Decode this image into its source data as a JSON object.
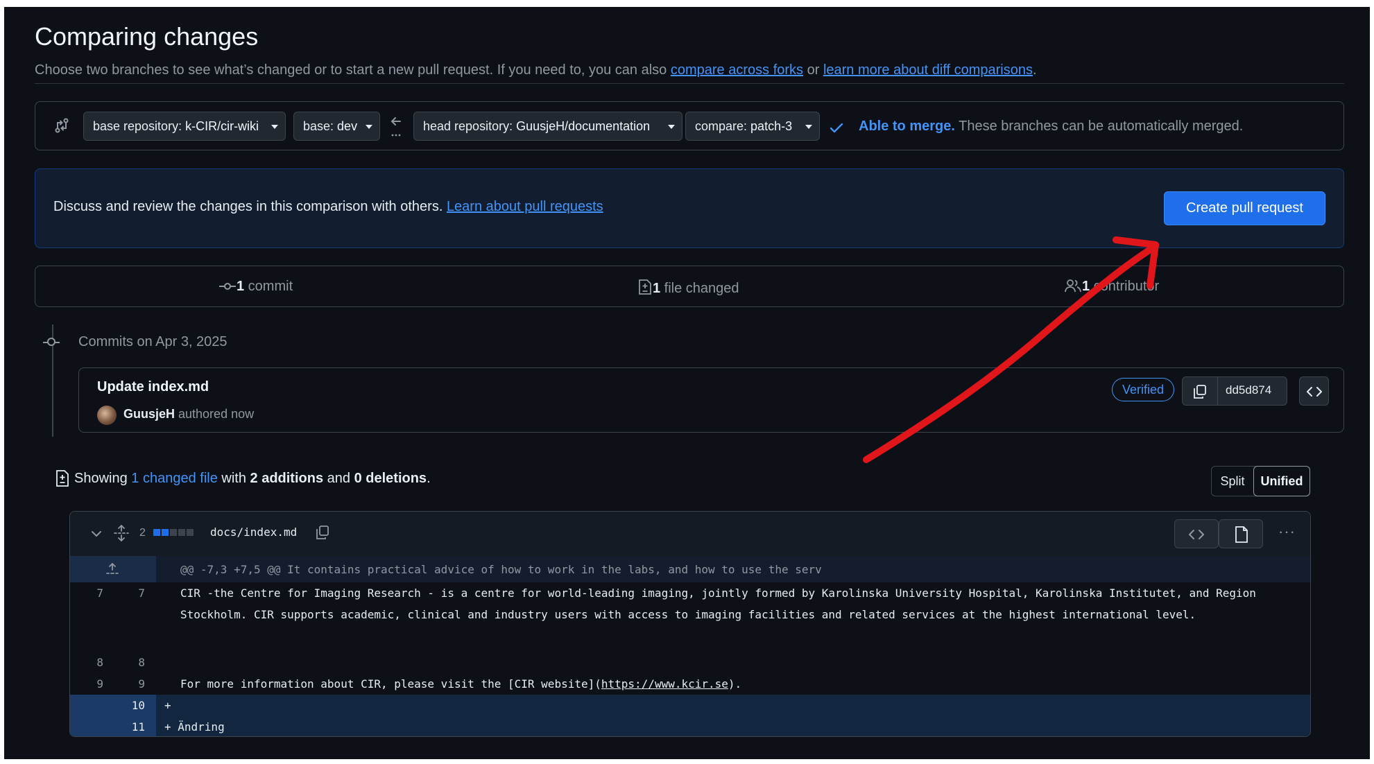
{
  "page": {
    "title": "Comparing changes",
    "subtitle_text": "Choose two branches to see what’s changed or to start a new pull request. If you need to, you can also ",
    "subtitle_link1": "compare across forks",
    "subtitle_or": " or ",
    "subtitle_link2": "learn more about diff comparisons",
    "subtitle_end": "."
  },
  "range": {
    "base_repo_label": "base repository: ",
    "base_repo_value": "k-CIR/cir-wiki",
    "base_label": "base: ",
    "base_value": "dev",
    "head_repo_label": "head repository: ",
    "head_repo_value": "GuusjeH/documentation",
    "compare_label": "compare: ",
    "compare_value": "patch-3",
    "merge_status": "Able to merge.",
    "merge_detail": " These branches can be automatically merged."
  },
  "banner": {
    "text": "Discuss and review the changes in this comparison with others. ",
    "link": "Learn about pull requests",
    "button": "Create pull request"
  },
  "stats": {
    "commits_count": "1",
    "commits_label": " commit",
    "files_count": "1",
    "files_label": " file changed",
    "contributors_count": "1",
    "contributors_label": " contributor"
  },
  "commits": {
    "date_heading": "Commits on Apr 3, 2025",
    "items": [
      {
        "title": "Update index.md",
        "author": "GuusjeH",
        "authored": " authored now",
        "verified": "Verified",
        "sha": "dd5d874"
      }
    ]
  },
  "summary": {
    "prefix": "Showing ",
    "link": "1 changed file",
    "mid1": " with ",
    "additions": "2 additions",
    "mid2": " and ",
    "deletions": "0 deletions",
    "end": ".",
    "split": "Split",
    "unified": "Unified"
  },
  "diff": {
    "changed_count": "2",
    "file_name": "docs/index.md",
    "hunk_header": "@@ -7,3 +7,5 @@ It contains practical advice of how to work in the labs, and how to use the serv",
    "lines": [
      {
        "old": "7",
        "new": "7",
        "text": "CIR -the Centre for Imaging Research - is a centre for world-leading imaging, jointly formed by Karolinska University Hospital, Karolinska Institutet, and Region Stockholm. CIR supports academic, clinical and industry users with access to imaging facilities and related services at the highest international level."
      },
      {
        "old": "8",
        "new": "8",
        "text": ""
      },
      {
        "old": "9",
        "new": "9",
        "text_before": "For more information about CIR, please visit the [CIR website](",
        "url": "https://www.kcir.se",
        "text_after": ")."
      },
      {
        "old": "",
        "new": "10",
        "text": "+ "
      },
      {
        "old": "",
        "new": "11",
        "text": "+ Ändring"
      }
    ]
  },
  "annotation": {
    "arrow_color": "#e0161b"
  }
}
